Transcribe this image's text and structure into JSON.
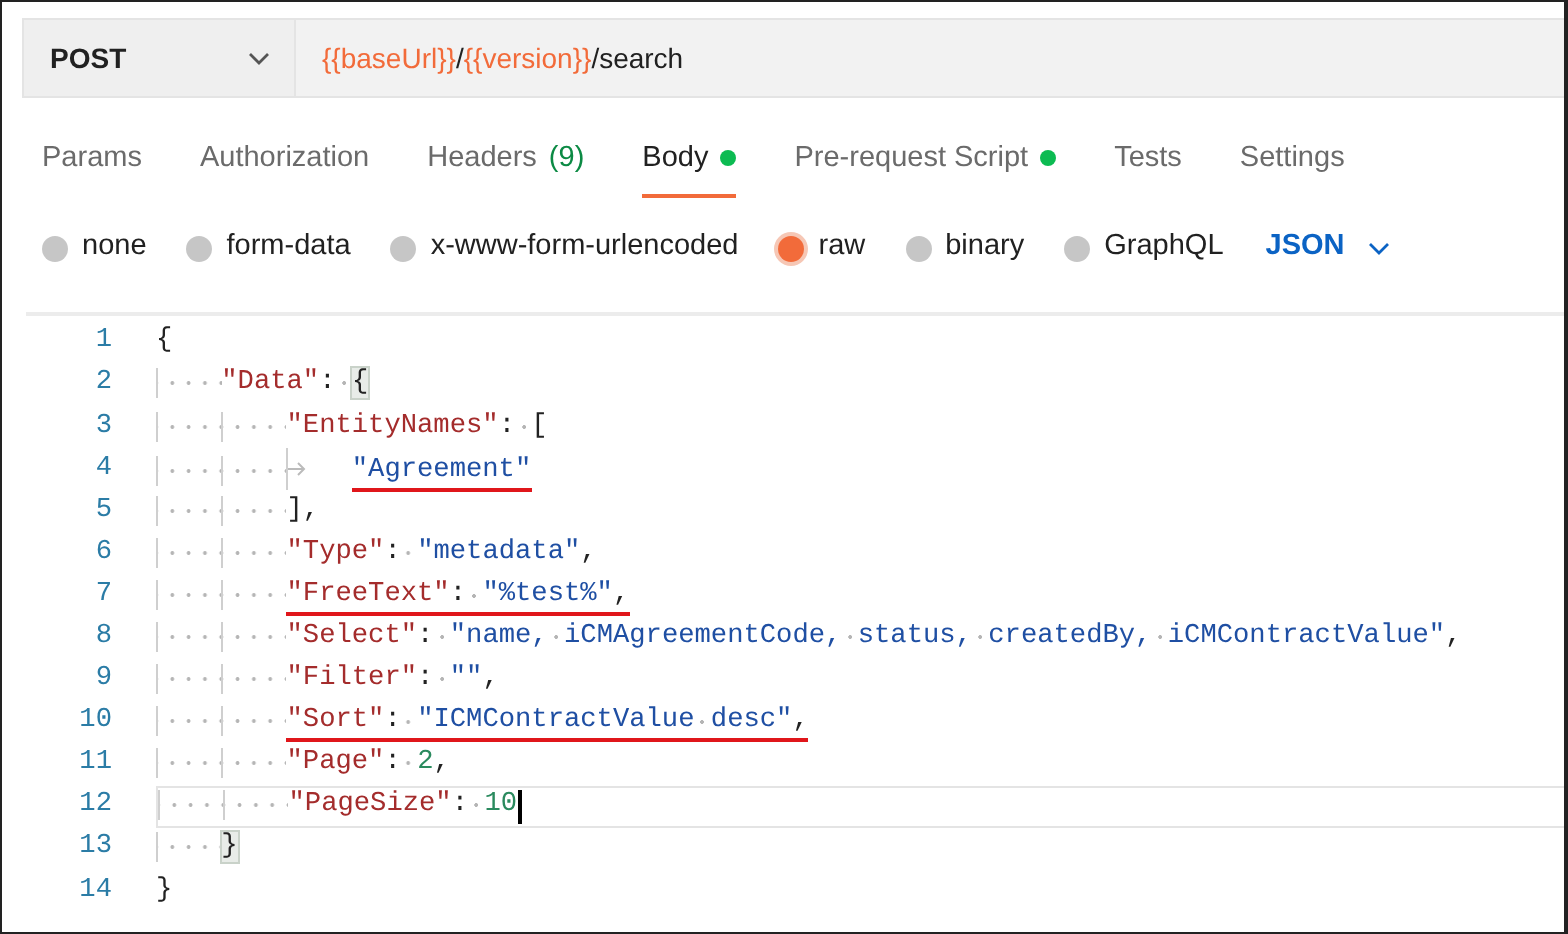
{
  "request": {
    "method": "POST",
    "url": [
      {
        "kind": "variable",
        "text": "{{baseUrl}}"
      },
      {
        "kind": "plain",
        "text": "/"
      },
      {
        "kind": "variable",
        "text": "{{version}}"
      },
      {
        "kind": "plain",
        "text": "/search"
      }
    ]
  },
  "tabs": [
    {
      "label": "Params",
      "selected": false,
      "indicator": false
    },
    {
      "label": "Authorization",
      "selected": false,
      "indicator": false
    },
    {
      "label": "Headers",
      "count": "(9)",
      "selected": false,
      "indicator": false
    },
    {
      "label": "Body",
      "selected": true,
      "indicator": true
    },
    {
      "label": "Pre-request Script",
      "selected": false,
      "indicator": true
    },
    {
      "label": "Tests",
      "selected": false,
      "indicator": false
    },
    {
      "label": "Settings",
      "selected": false,
      "indicator": false
    }
  ],
  "body_types": [
    {
      "label": "none",
      "selected": false
    },
    {
      "label": "form-data",
      "selected": false
    },
    {
      "label": "x-www-form-urlencoded",
      "selected": false
    },
    {
      "label": "raw",
      "selected": true
    },
    {
      "label": "binary",
      "selected": false
    },
    {
      "label": "GraphQL",
      "selected": false
    }
  ],
  "format": "JSON",
  "editor": {
    "lines": [
      {
        "number": "1",
        "current": false,
        "tokens": [
          {
            "kind": "punct",
            "text": "{"
          }
        ]
      },
      {
        "number": "2",
        "current": false,
        "tokens": [
          {
            "kind": "key",
            "text": "    \"Data\""
          },
          {
            "kind": "punct",
            "text": ": "
          },
          {
            "kind": "punct",
            "text": "{",
            "highlighted": true
          }
        ]
      },
      {
        "number": "3",
        "current": false,
        "tokens": [
          {
            "kind": "key",
            "text": "        \"EntityNames\""
          },
          {
            "kind": "punct",
            "text": ": ["
          }
        ]
      },
      {
        "number": "4",
        "current": false,
        "tokens": [
          {
            "kind": "string",
            "text": "        \t\"Agreement\"",
            "underlined": true
          }
        ]
      },
      {
        "number": "5",
        "current": false,
        "tokens": [
          {
            "kind": "punct",
            "text": "        ],"
          }
        ]
      },
      {
        "number": "6",
        "current": false,
        "tokens": [
          {
            "kind": "key",
            "text": "        \"Type\""
          },
          {
            "kind": "punct",
            "text": ": "
          },
          {
            "kind": "string",
            "text": "\"metadata\""
          },
          {
            "kind": "punct",
            "text": ","
          }
        ]
      },
      {
        "number": "7",
        "current": false,
        "tokens": [
          {
            "kind": "key",
            "text": "        \"FreeText\"",
            "underlined": true
          },
          {
            "kind": "punct",
            "text": ": ",
            "underlined": true
          },
          {
            "kind": "string",
            "text": "\"%test%\"",
            "underlined": true
          },
          {
            "kind": "punct",
            "text": ",",
            "underlined": true
          }
        ]
      },
      {
        "number": "8",
        "current": false,
        "tokens": [
          {
            "kind": "key",
            "text": "        \"Select\""
          },
          {
            "kind": "punct",
            "text": ": "
          },
          {
            "kind": "string",
            "text": "\"name, iCMAgreementCode, status, createdBy, iCMContractValue\""
          },
          {
            "kind": "punct",
            "text": ","
          }
        ]
      },
      {
        "number": "9",
        "current": false,
        "tokens": [
          {
            "kind": "key",
            "text": "        \"Filter\""
          },
          {
            "kind": "punct",
            "text": ": "
          },
          {
            "kind": "string",
            "text": "\"\""
          },
          {
            "kind": "punct",
            "text": ","
          }
        ]
      },
      {
        "number": "10",
        "current": false,
        "tokens": [
          {
            "kind": "key",
            "text": "        \"Sort\"",
            "underlined": true
          },
          {
            "kind": "punct",
            "text": ": ",
            "underlined": true
          },
          {
            "kind": "string",
            "text": "\"ICMContractValue desc\"",
            "underlined": true
          },
          {
            "kind": "punct",
            "text": ",",
            "underlined": true
          }
        ]
      },
      {
        "number": "11",
        "current": false,
        "tokens": [
          {
            "kind": "key",
            "text": "        \"Page\""
          },
          {
            "kind": "punct",
            "text": ": "
          },
          {
            "kind": "number",
            "text": "2"
          },
          {
            "kind": "punct",
            "text": ","
          }
        ]
      },
      {
        "number": "12",
        "current": true,
        "tokens": [
          {
            "kind": "key",
            "text": "        \"PageSize\""
          },
          {
            "kind": "punct",
            "text": ": "
          },
          {
            "kind": "number",
            "text": "10"
          }
        ]
      },
      {
        "number": "13",
        "current": false,
        "tokens": [
          {
            "kind": "punct",
            "text": "    }",
            "highlighted": true
          }
        ]
      },
      {
        "number": "14",
        "current": false,
        "tokens": [
          {
            "kind": "punct",
            "text": "}"
          }
        ]
      }
    ]
  }
}
